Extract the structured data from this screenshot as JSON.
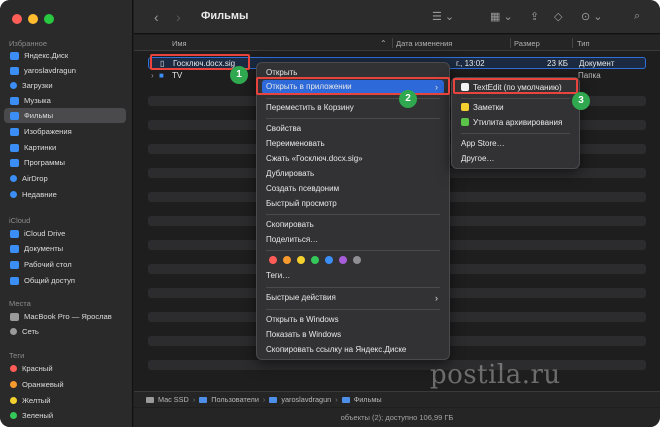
{
  "window": {
    "title": "Фильмы"
  },
  "sidebar": {
    "sections": [
      {
        "label": "Избранное",
        "items": [
          {
            "label": "Яндекс.Диск"
          },
          {
            "label": "yaroslavdragun"
          },
          {
            "label": "Загрузки"
          },
          {
            "label": "Музыка"
          },
          {
            "label": "Фильмы",
            "active": true
          },
          {
            "label": "Изображения"
          },
          {
            "label": "Картинки"
          },
          {
            "label": "Программы"
          },
          {
            "label": "AirDrop"
          },
          {
            "label": "Недавние"
          }
        ]
      },
      {
        "label": "iCloud",
        "items": [
          {
            "label": "iCloud Drive"
          },
          {
            "label": "Документы"
          },
          {
            "label": "Рабочий стол"
          },
          {
            "label": "Общий доступ"
          }
        ]
      },
      {
        "label": "Места",
        "items": [
          {
            "label": "MacBook Pro — Ярослав"
          },
          {
            "label": "Сеть"
          }
        ]
      },
      {
        "label": "Теги",
        "items": [
          {
            "label": "Красный",
            "color": "#ff5b57"
          },
          {
            "label": "Оранжевый",
            "color": "#f79a2e"
          },
          {
            "label": "Желтый",
            "color": "#f5d12f"
          },
          {
            "label": "Зеленый",
            "color": "#34c759"
          }
        ]
      }
    ]
  },
  "columns": {
    "name": "Имя",
    "modified": "Дата изменения",
    "size": "Размер",
    "kind": "Тип"
  },
  "files": [
    {
      "name": "Госключ.docx.sig",
      "modified": "г., 13:02",
      "size": "23 КБ",
      "kind": "Документ"
    },
    {
      "name": "TV",
      "modified": "",
      "size": "",
      "kind": "Папка"
    }
  ],
  "context_menu": {
    "open": "Открыть",
    "open_with": "Открыть в приложении",
    "trash": "Переместить в Корзину",
    "info": "Свойства",
    "rename": "Переименовать",
    "compress": "Сжать «Госключ.docx.sig»",
    "duplicate": "Дублировать",
    "alias": "Создать псевдоним",
    "quicklook": "Быстрый просмотр",
    "copy": "Скопировать",
    "share": "Поделиться…",
    "tags": "Теги…",
    "tag_colors": [
      "#ff5b57",
      "#f79a2e",
      "#f5d12f",
      "#34c759",
      "#3a8ef6",
      "#a75cd9",
      "#8e8e93"
    ],
    "quick_actions": "Быстрые действия",
    "open_windows": "Открыть в Windows",
    "show_windows": "Показать в Windows",
    "copy_link": "Скопировать ссылку на Яндекс.Диске"
  },
  "submenu": {
    "textedit": "TextEdit (по умолчанию)",
    "notes": "Заметки",
    "archive": "Утилита архивирования",
    "appstore": "App Store…",
    "other": "Другое…"
  },
  "badges": [
    "1",
    "2",
    "3"
  ],
  "pathbar": [
    "Mac SSD",
    "Пользователи",
    "yaroslavdragun",
    "Фильмы"
  ],
  "status": "объекты (2); доступно 106,99 ГБ",
  "watermark": "postila.ru"
}
